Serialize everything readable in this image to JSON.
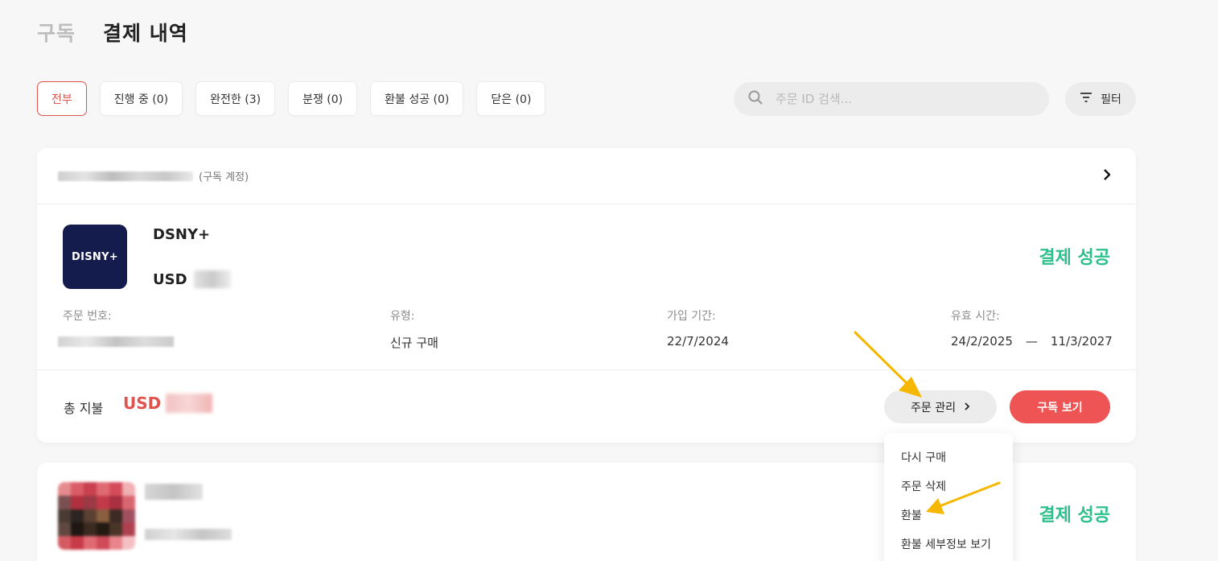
{
  "page_tabs": [
    {
      "label": "구독",
      "active": false
    },
    {
      "label": "결제 내역",
      "active": true
    }
  ],
  "filters": [
    {
      "label": "전부",
      "active": true
    },
    {
      "label": "진행 중 (0)",
      "active": false
    },
    {
      "label": "완전한 (3)",
      "active": false
    },
    {
      "label": "분쟁 (0)",
      "active": false
    },
    {
      "label": "환불 성공 (0)",
      "active": false
    },
    {
      "label": "닫은 (0)",
      "active": false
    }
  ],
  "search": {
    "placeholder": "주문 ID 검색...",
    "value": "",
    "icon": "search-icon"
  },
  "filter_button": {
    "label": "필터",
    "icon": "filter-icon"
  },
  "orders": [
    {
      "account_suffix": "(구독 계정)",
      "logo_text": "DISNY+",
      "product_name": "DSNY+",
      "currency": "USD",
      "status": "결제 성공",
      "order_number_label": "주문 번호:",
      "type_label": "유형:",
      "type_value": "신규 구매",
      "signup_label": "가입 기간:",
      "signup_value": "22/7/2024",
      "validity_label": "유효 시간:",
      "validity_start": "24/2/2025",
      "validity_sep": "—",
      "validity_end": "11/3/2027",
      "total_label": "총 지불",
      "total_currency": "USD",
      "manage_button": "주문 관리",
      "view_button": "구독 보기"
    },
    {
      "status": "결제 성공"
    }
  ],
  "dropdown": {
    "items": [
      "다시 구매",
      "주문 삭제",
      "환불",
      "환불 세부정보 보기"
    ]
  },
  "colors": {
    "accent_red": "#ed5453",
    "success_green": "#2dbf8c",
    "annotation_arrow": "#f5b700",
    "logo_bg": "#141b4d"
  }
}
